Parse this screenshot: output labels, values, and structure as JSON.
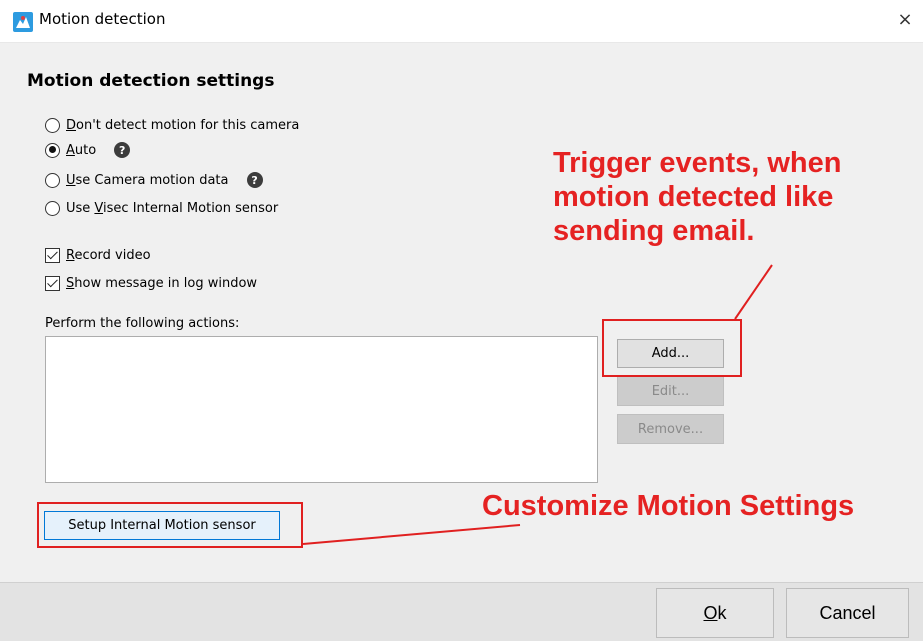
{
  "window": {
    "title": "Motion detection",
    "app_icon": "camera-app-icon",
    "close_glyph": "×"
  },
  "settings": {
    "heading": "Motion detection settings",
    "radios": [
      {
        "label_prefix": "",
        "label_underlined": "D",
        "label_rest": "on't detect motion for this camera",
        "checked": false
      },
      {
        "label_prefix": "",
        "label_underlined": "A",
        "label_rest": "uto",
        "checked": true,
        "help": "?"
      },
      {
        "label_prefix": "",
        "label_underlined": "U",
        "label_rest": "se Camera motion data",
        "checked": false,
        "help": "?"
      },
      {
        "label_prefix": "Use ",
        "label_underlined": "V",
        "label_rest": "isec Internal Motion sensor",
        "checked": false
      }
    ],
    "checkboxes": [
      {
        "label_underlined": "R",
        "label_rest": "ecord video",
        "checked": true
      },
      {
        "label_underlined": "S",
        "label_rest": "how message in log window",
        "checked": true
      }
    ],
    "actions_label": "Perform the following actions:",
    "buttons": {
      "add": "Add...",
      "edit": "Edit...",
      "remove": "Remove..."
    },
    "setup_button": "Setup Internal Motion sensor"
  },
  "annotations": {
    "trigger_line1": "Trigger events, when",
    "trigger_line2": "motion detected like",
    "trigger_line3": "sending email.",
    "customize": "Customize Motion Settings",
    "color": "#e52222"
  },
  "footer": {
    "ok_underlined": "O",
    "ok_rest": "k",
    "cancel": "Cancel"
  }
}
